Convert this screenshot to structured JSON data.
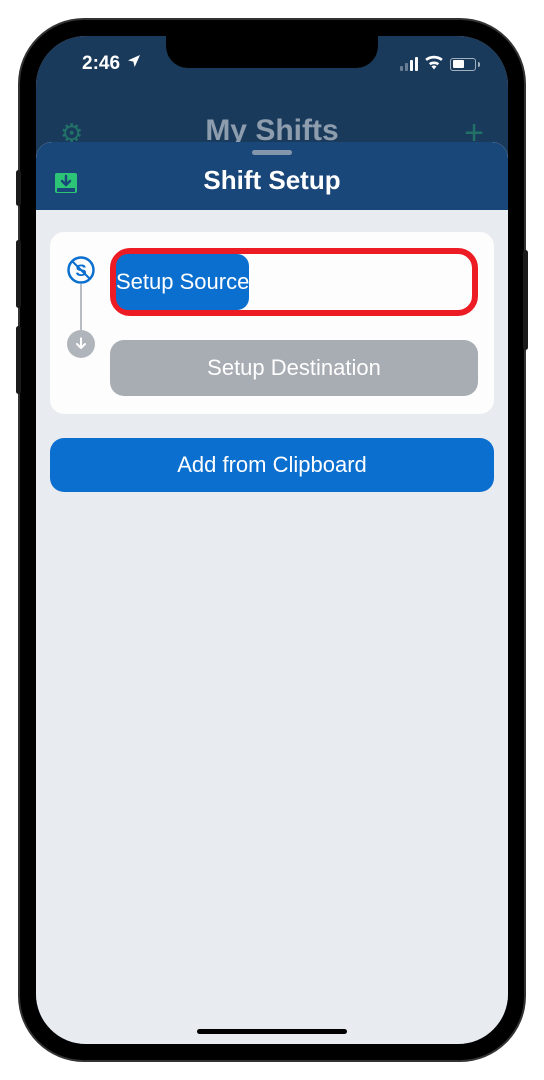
{
  "status": {
    "time": "2:46"
  },
  "background": {
    "title": "My Shifts"
  },
  "sheet": {
    "title": "Shift Setup",
    "btn_source": "Setup Source",
    "btn_destination": "Setup Destination",
    "btn_clipboard": "Add from Clipboard"
  }
}
